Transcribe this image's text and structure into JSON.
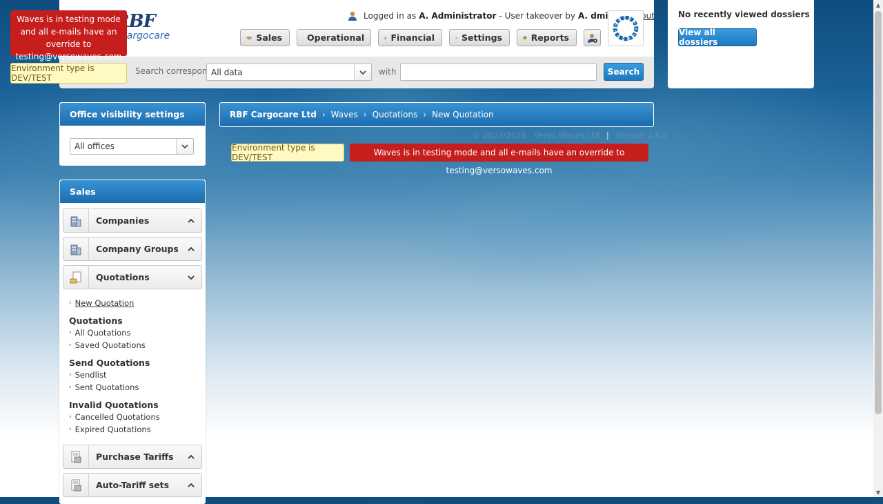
{
  "header": {
    "logo_main": "RBF",
    "logo_sub": "Cargocare",
    "user": {
      "prefix": "Logged in as",
      "name": "A. Administrator",
      "takeover_text": "- User takeover by",
      "takeover_name": "A. dmin",
      "logout": "Log out"
    },
    "nav": [
      {
        "label": "Sales",
        "icon": "handshake-icon"
      },
      {
        "label": "Operational",
        "icon": "folder-icon"
      },
      {
        "label": "Financial",
        "icon": "calculator-icon"
      },
      {
        "label": "Settings",
        "icon": "gear-icon"
      },
      {
        "label": "Reports",
        "icon": "chart-icon"
      }
    ],
    "search": {
      "label": "Search corresponding dossiers in",
      "scope": "All data",
      "with_label": "with",
      "query": "",
      "button": "Search"
    }
  },
  "recent": {
    "title": "No recently viewed dossiers",
    "button": "View all dossiers"
  },
  "warnings": {
    "testing_mode": "Waves is in testing mode and all e-mails have an override to testing@versowaves.com",
    "environment": "Environment type is DEV/TEST"
  },
  "office_panel": {
    "title": "Office visibility settings",
    "selected": "All offices"
  },
  "sales_panel": {
    "title": "Sales",
    "sections": {
      "companies": "Companies",
      "company_groups": "Company Groups",
      "quotations": "Quotations",
      "purchase_tariffs": "Purchase Tariffs",
      "auto_tariff_sets": "Auto-Tariff sets"
    },
    "quotations_menu": {
      "new_quotation": "New Quotation",
      "group_quotations": "Quotations",
      "all_quotations": "All Quotations",
      "saved_quotations": "Saved Quotations",
      "group_send": "Send Quotations",
      "sendlist": "Sendlist",
      "sent_quotations": "Sent Quotations",
      "group_invalid": "Invalid Quotations",
      "cancelled_quotations": "Cancelled Quotations",
      "expired_quotations": "Expired Quotations"
    }
  },
  "breadcrumb": [
    "RBF Cargocare Ltd",
    "Waves",
    "Quotations",
    "New Quotation"
  ],
  "footer": {
    "copyright": "© 2023/2025 - Verso Waves Ltd",
    "version": "Version 2.6.0"
  },
  "colors": {
    "accent_blue": "#1f78bf",
    "warning_red": "#c61d1d",
    "warning_yellow": "#fff9c4"
  }
}
